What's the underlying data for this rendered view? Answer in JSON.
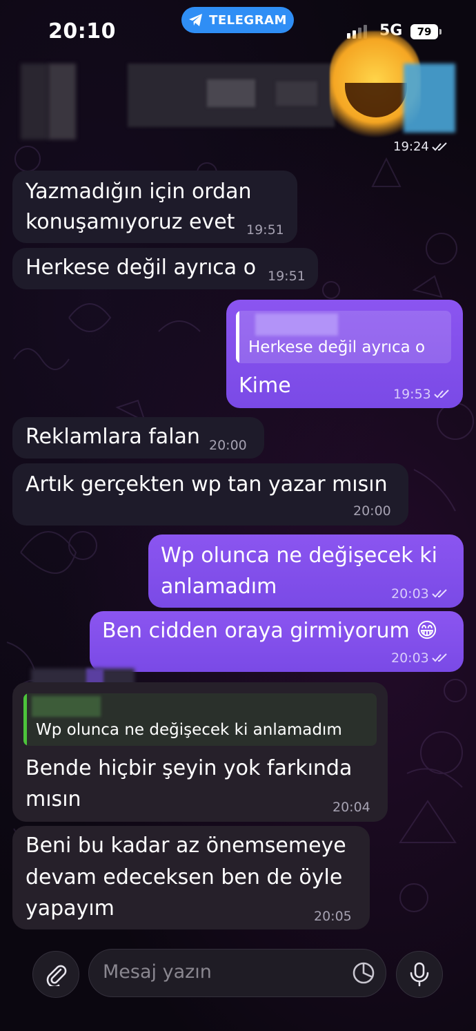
{
  "status_bar": {
    "time": "20:10",
    "app_badge": "TELEGRAM",
    "network": "5G",
    "battery": "79"
  },
  "chat": {
    "top_message_time": "19:24",
    "messages": [
      {
        "direction": "in",
        "text_lines": [
          "Yazmadığın için ordan",
          "konuşamıyoruz evet"
        ],
        "time": "19:51"
      },
      {
        "direction": "in",
        "text_lines": [
          "Herkese değil ayrıca o"
        ],
        "time": "19:51"
      },
      {
        "direction": "out",
        "reply_quote": "Herkese değil ayrıca o",
        "text_lines": [
          "Kime"
        ],
        "time": "19:53"
      },
      {
        "direction": "in",
        "text_lines": [
          "Reklamlara falan"
        ],
        "time": "20:00"
      },
      {
        "direction": "in",
        "text_lines": [
          "Artık gerçekten wp tan yazar mısın"
        ],
        "time": "20:00"
      },
      {
        "direction": "out",
        "text_lines": [
          "Wp olunca ne değişecek ki",
          "anlamadım"
        ],
        "time": "20:03"
      },
      {
        "direction": "out",
        "text_lines": [
          "Ben cidden oraya girmiyorum 😁"
        ],
        "time": "20:03"
      },
      {
        "direction": "in",
        "reply_quote": "Wp olunca ne değişecek ki anlamadım",
        "text_lines": [
          "Bende hiçbir şeyin yok farkında",
          "mısın"
        ],
        "time": "20:04"
      },
      {
        "direction": "in",
        "text_lines": [
          "Beni bu kadar az önemsemeye",
          "devam edeceksen ben de öyle",
          "yapayım"
        ],
        "time": "20:05"
      }
    ]
  },
  "composer": {
    "placeholder": "Mesaj yazın",
    "icons": [
      "paperclip-icon",
      "sticker-icon",
      "microphone-icon"
    ]
  },
  "colors": {
    "outgoing_bubble": "#8b55f0",
    "incoming_bubble": "#1e1b2a",
    "telegram_blue": "#2f8ef5",
    "reply_bar_green": "#4cc43b",
    "background": "#0b0710"
  }
}
